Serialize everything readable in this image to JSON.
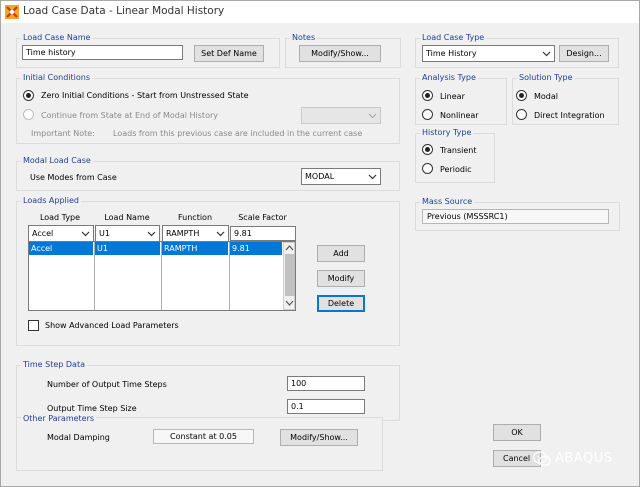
{
  "window": {
    "title": "Load Case Data - Linear Modal History"
  },
  "load_case_name": {
    "label": "Load Case Name",
    "value": "Time history",
    "set_def_button": "Set Def Name"
  },
  "notes": {
    "label": "Notes",
    "button": "Modify/Show..."
  },
  "load_case_type": {
    "label": "Load Case Type",
    "value": "Time History",
    "design_button": "Design..."
  },
  "initial_conditions": {
    "label": "Initial Conditions",
    "option_zero": "Zero Initial Conditions - Start from Unstressed State",
    "option_continue": "Continue from State at End of Modal History",
    "important_label": "Important Note:",
    "important_text": "Loads from this previous case are included in the current case"
  },
  "analysis_type": {
    "label": "Analysis Type",
    "linear": "Linear",
    "nonlinear": "Nonlinear"
  },
  "solution_type": {
    "label": "Solution Type",
    "modal": "Modal",
    "direct": "Direct Integration"
  },
  "history_type": {
    "label": "History Type",
    "transient": "Transient",
    "periodic": "Periodic"
  },
  "modal_load_case": {
    "label": "Modal Load Case",
    "use_modes_label": "Use Modes from Case",
    "value": "MODAL"
  },
  "mass_source": {
    "label": "Mass Source",
    "value": "Previous  (MSSSRC1)"
  },
  "loads_applied": {
    "label": "Loads Applied",
    "columns": [
      "Load Type",
      "Load Name",
      "Function",
      "Scale Factor"
    ],
    "edit_row": [
      "Accel",
      "U1",
      "RAMPTH",
      "9.81"
    ],
    "rows": [
      [
        "Accel",
        "U1",
        "RAMPTH",
        "9.81"
      ]
    ],
    "add_button": "Add",
    "modify_button": "Modify",
    "delete_button": "Delete",
    "advanced_label": "Show Advanced Load Parameters"
  },
  "time_step_data": {
    "label": "Time Step Data",
    "num_steps_label": "Number of Output Time Steps",
    "num_steps_value": "100",
    "step_size_label": "Output Time Step Size",
    "step_size_value": "0.1"
  },
  "other_parameters": {
    "label": "Other Parameters",
    "damping_label": "Modal Damping",
    "damping_value": "Constant at 0.05",
    "damping_button": "Modify/Show..."
  },
  "dialog_buttons": {
    "ok": "OK",
    "cancel": "Cancel"
  },
  "watermark": {
    "text": "ABAQUS"
  }
}
